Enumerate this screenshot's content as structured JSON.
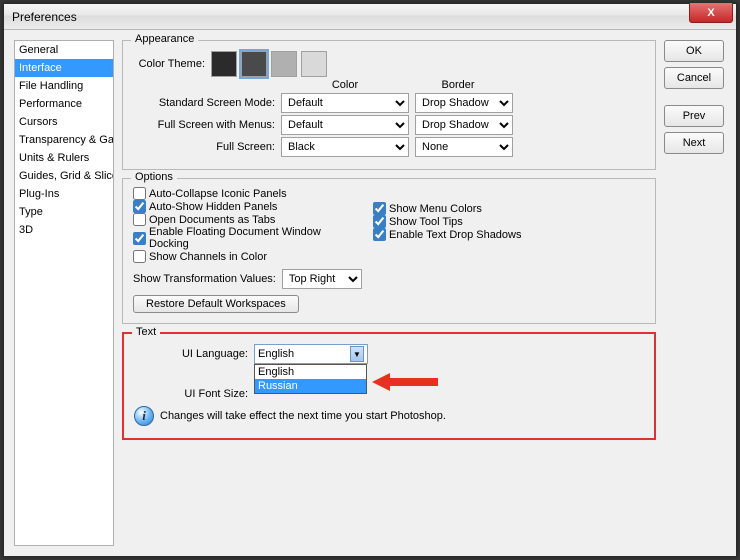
{
  "window": {
    "title": "Preferences"
  },
  "sidebar": {
    "items": [
      "General",
      "Interface",
      "File Handling",
      "Performance",
      "Cursors",
      "Transparency & Gamut",
      "Units & Rulers",
      "Guides, Grid & Slices",
      "Plug-Ins",
      "Type",
      "3D"
    ],
    "selectedIndex": 1
  },
  "buttons": {
    "ok": "OK",
    "cancel": "Cancel",
    "prev": "Prev",
    "next": "Next",
    "restore": "Restore Default Workspaces"
  },
  "appearance": {
    "legend": "Appearance",
    "colorThemeLabel": "Color Theme:",
    "swatches": [
      "#2b2b2b",
      "#4a4a4a",
      "#b0b0b0",
      "#d9d9d9"
    ],
    "swatchSelected": 1,
    "headers": {
      "color": "Color",
      "border": "Border"
    },
    "rows": {
      "standard": {
        "label": "Standard Screen Mode:",
        "color": "Default",
        "border": "Drop Shadow"
      },
      "fullMenus": {
        "label": "Full Screen with Menus:",
        "color": "Default",
        "border": "Drop Shadow"
      },
      "full": {
        "label": "Full Screen:",
        "color": "Black",
        "border": "None"
      }
    }
  },
  "options": {
    "legend": "Options",
    "autoCollapse": {
      "label": "Auto-Collapse Iconic Panels",
      "checked": false
    },
    "autoShow": {
      "label": "Auto-Show Hidden Panels",
      "checked": true
    },
    "openTabs": {
      "label": "Open Documents as Tabs",
      "checked": false
    },
    "enableDock": {
      "label": "Enable Floating Document Window Docking",
      "checked": true
    },
    "showChannels": {
      "label": "Show Channels in Color",
      "checked": false
    },
    "showMenuColors": {
      "label": "Show Menu Colors",
      "checked": true
    },
    "showToolTips": {
      "label": "Show Tool Tips",
      "checked": true
    },
    "enableDropShadows": {
      "label": "Enable Text Drop Shadows",
      "checked": true
    },
    "transformLabel": "Show Transformation Values:",
    "transformValue": "Top Right"
  },
  "text": {
    "legend": "Text",
    "languageLabel": "UI Language:",
    "languageValue": "English",
    "languageOptions": [
      "English",
      "Russian"
    ],
    "languageHighlightIndex": 1,
    "fontSizeLabel": "UI Font Size:",
    "infoText": "Changes will take effect the next time you start Photoshop."
  }
}
